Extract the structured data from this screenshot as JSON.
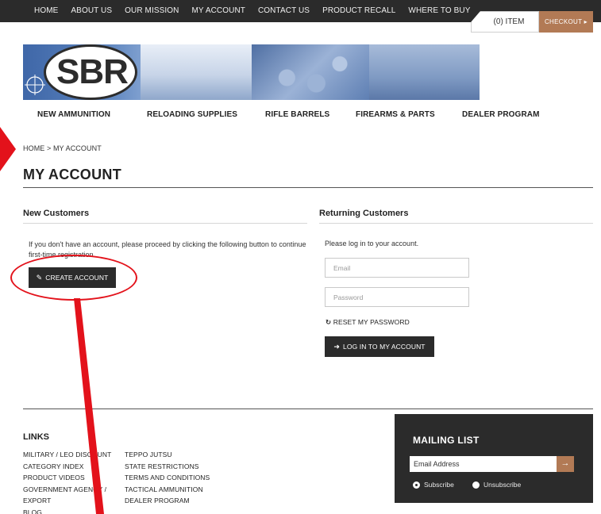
{
  "topnav": {
    "items": [
      "HOME",
      "ABOUT US",
      "OUR MISSION",
      "MY ACCOUNT",
      "CONTACT US",
      "PRODUCT RECALL",
      "WHERE TO BUY"
    ]
  },
  "cart": {
    "items_label": "(0) ITEM",
    "checkout_label": "CHECKOUT",
    "checkout_icon": "triangle-right-icon"
  },
  "logo": {
    "text": "SBR"
  },
  "catnav": {
    "items": [
      "NEW AMMUNITION",
      "RELOADING SUPPLIES",
      "RIFLE BARRELS",
      "FIREARMS & PARTS",
      "DEALER PROGRAM"
    ]
  },
  "breadcrumb": "HOME > MY ACCOUNT",
  "page_title": "MY ACCOUNT",
  "new_customers": {
    "heading": "New Customers",
    "text": "If you don't have an account, please proceed by clicking the following button to continue first-time registration.",
    "button_label": "CREATE ACCOUNT",
    "button_icon": "pencil-icon"
  },
  "returning_customers": {
    "heading": "Returning Customers",
    "text": "Please log in to your account.",
    "email_placeholder": "Email",
    "password_placeholder": "Password",
    "reset_label": "RESET MY PASSWORD",
    "reset_icon": "refresh-icon",
    "login_label": "LOG IN TO MY ACCOUNT",
    "login_icon": "sign-in-icon"
  },
  "footer": {
    "links_title": "LINKS",
    "col1": [
      "MILITARY / LEO DISCOUNT",
      "CATEGORY INDEX",
      "PRODUCT VIDEOS",
      "GOVERNMENT AGENCY /",
      "EXPORT",
      "BLOG"
    ],
    "col2": [
      "TEPPO JUTSU",
      "STATE RESTRICTIONS",
      "TERMS AND CONDITIONS",
      "TACTICAL AMMUNITION",
      "DEALER PROGRAM"
    ]
  },
  "mailing": {
    "title": "MAILING LIST",
    "placeholder": "Email Address",
    "go_icon": "arrow-right-icon",
    "subscribe_label": "Subscribe",
    "unsubscribe_label": "Unsubscribe"
  },
  "colors": {
    "dark": "#2b2b2b",
    "accent": "#b27a55",
    "annotation": "#e3121b",
    "banner_blue": "#4f6fa3"
  }
}
